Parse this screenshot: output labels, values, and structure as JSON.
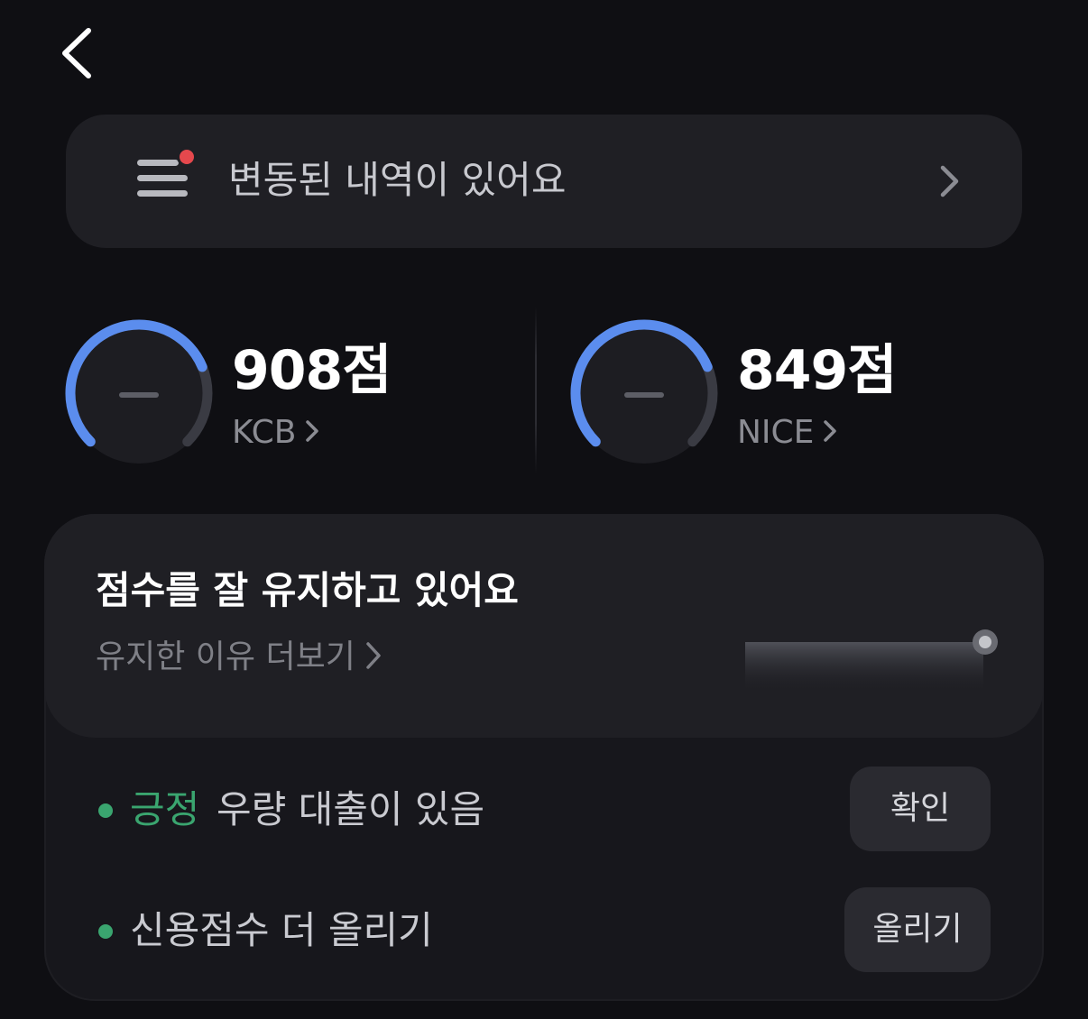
{
  "header": {
    "back_icon": "chevron-left-icon"
  },
  "notice": {
    "icon": "list-with-badge-icon",
    "text": "변동된 내역이 있어요",
    "badge_color": "#e5484d"
  },
  "scores": [
    {
      "value_text": "908점",
      "agency": "KCB",
      "gauge_fraction": 0.75,
      "gauge_color": "#5b8dee"
    },
    {
      "value_text": "849점",
      "agency": "NICE",
      "gauge_fraction": 0.75,
      "gauge_color": "#5b8dee"
    }
  ],
  "status": {
    "title": "점수를 잘 유지하고 있어요",
    "link_text": "유지한 이유 더보기",
    "items": [
      {
        "tag": "긍정",
        "text": "우량 대출이 있음",
        "button_label": "확인"
      },
      {
        "tag": "",
        "text": "신용점수 더 올리기",
        "button_label": "올리기"
      }
    ],
    "positive_color": "#3aa56f"
  }
}
